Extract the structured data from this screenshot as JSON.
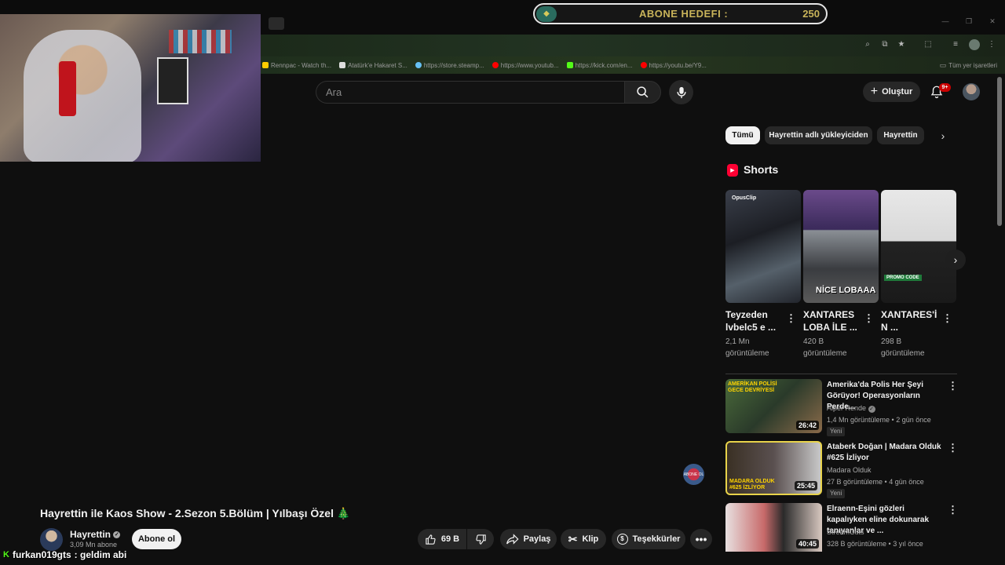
{
  "goal": {
    "label": "ABONE HEDEFI :",
    "value": "250"
  },
  "bookmarks": [
    {
      "label": "Rennpac - Watch th...",
      "color": "#ffcc00"
    },
    {
      "label": "Atatürk'e Hakaret S...",
      "color": "#dddddd"
    },
    {
      "label": "https://store.steamp...",
      "color": "#66c0f4"
    },
    {
      "label": "https://www.youtub...",
      "color": "#ff0000"
    },
    {
      "label": "https://kick.com/en...",
      "color": "#53fc18"
    },
    {
      "label": "https://youtu.be/Y9...",
      "color": "#ff0000"
    }
  ],
  "bookmarks_all": "Tüm yer işaretleri",
  "search": {
    "placeholder": "Ara"
  },
  "header": {
    "create_label": "Oluştur",
    "notifications": "9+"
  },
  "chips": [
    "Tümü",
    "Hayrettin adlı yükleyiciden",
    "Hayrettin"
  ],
  "shorts": {
    "title": "Shorts",
    "items": [
      {
        "title": "Teyzeden lvbelc5 e ...",
        "views": "2,1 Mn görüntüleme",
        "overlay": "OpusClip"
      },
      {
        "title": "XANTARES LOBA İLE ...",
        "views": "420 B görüntüleme",
        "overlay": "NİCE LOBAAA"
      },
      {
        "title": "XANTARES'İ N ...",
        "views": "298 B görüntüleme",
        "overlay": "PROMO CODE"
      }
    ]
  },
  "related": [
    {
      "title": "Amerika'da Polis Her Şeyi Görüyor! Operasyonların Perde...",
      "channel": "Alper Rende",
      "meta": "1,4 Mn görüntüleme • 2 gün önce",
      "badge": "Yeni",
      "duration": "26:42",
      "thumb_text": "AMERİKAN POLİSİ GECE DEVRİYESİ"
    },
    {
      "title": "Ataberk Doğan | Madara Olduk #625 İzliyor",
      "channel": "Madara Olduk",
      "meta": "27 B görüntüleme • 4 gün önce",
      "badge": "Yeni",
      "duration": "25:45",
      "thumb_text": "MADARA OLDUK #625 İZLİYOR"
    },
    {
      "title": "Elraenn-Eşini gözleri kapalıyken eline dokunarak tanıyanlar ve ...",
      "channel": "StreamCuts",
      "meta": "328 B görüntüleme • 3 yıl önce",
      "badge": "",
      "duration": "40:45",
      "thumb_text": ""
    }
  ],
  "video": {
    "title": "Hayrettin ile Kaos Show - 2.Sezon 5.Bölüm | Yılbaşı Özel 🎄",
    "channel": "Hayrettin",
    "subs": "3,09 Mn abone",
    "subscribe": "Abone ol",
    "likes": "69 B",
    "share": "Paylaş",
    "clip": "Klip",
    "thanks": "Teşekkürler"
  },
  "overlay_badge": "ABONE OL",
  "chat": {
    "platform": "K",
    "user": "furkan019gts",
    "message": ": geldim abi"
  }
}
